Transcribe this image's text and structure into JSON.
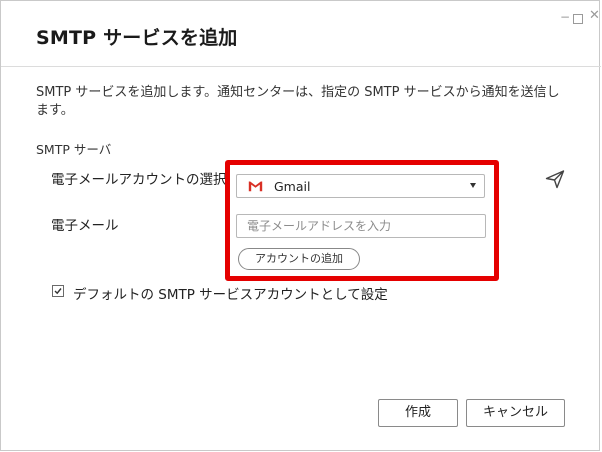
{
  "dialog": {
    "title": "SMTP サービスを追加",
    "description": "SMTP サービスを追加します。通知センターは、指定の SMTP サービスから通知を送信します。"
  },
  "form": {
    "section_label": "SMTP サーバ",
    "account_label": "電子メールアカウントの選択",
    "account_value": "Gmail",
    "email_label": "電子メール",
    "email_placeholder": "電子メールアドレスを入力",
    "add_account_label": "アカウントの追加",
    "default_label": "デフォルトの SMTP サービスアカウントとして設定",
    "default_checked": true
  },
  "buttons": {
    "create": "作成",
    "cancel": "キャンセル"
  },
  "colors": {
    "highlight": "#e50000",
    "gmail_red": "#d93025"
  },
  "icons": [
    "gmail-icon",
    "dropdown-caret-icon",
    "send-icon",
    "checkbox-check-icon",
    "minimize-icon",
    "maximize-icon",
    "close-icon"
  ]
}
